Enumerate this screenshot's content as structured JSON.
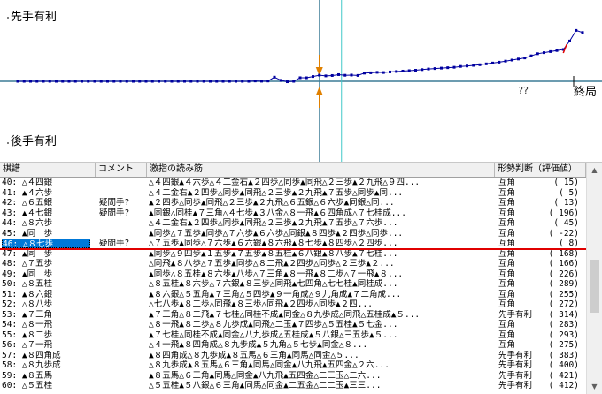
{
  "chart": {
    "y_top_label": "先手有利",
    "y_bottom_label": "後手有利",
    "x_end_label": "終局",
    "question_mark": "??",
    "colors": {
      "line": "#0000a0",
      "center": "#3c7c96",
      "cursor": "#40c8c8",
      "marker": "#e08000",
      "bad": "#e00000"
    }
  },
  "chart_data": {
    "type": "line",
    "title": "",
    "xlabel": "",
    "ylabel": "",
    "ylim": [
      -3000,
      3000
    ],
    "x": [
      1,
      2,
      3,
      4,
      5,
      6,
      7,
      8,
      9,
      10,
      11,
      12,
      13,
      14,
      15,
      16,
      17,
      18,
      19,
      20,
      21,
      22,
      23,
      24,
      25,
      26,
      27,
      28,
      29,
      30,
      31,
      32,
      33,
      34,
      35,
      36,
      37,
      38,
      39,
      40,
      41,
      42,
      43,
      44,
      45,
      46,
      47,
      48,
      49,
      50,
      51,
      52,
      53,
      54,
      55,
      56,
      57,
      58,
      59,
      60,
      61,
      62,
      63,
      64,
      65,
      66,
      67,
      68,
      69,
      70,
      71,
      72,
      73,
      74,
      75,
      76,
      77,
      78,
      79,
      80,
      81,
      82,
      83,
      84,
      85,
      86,
      87,
      88,
      89
    ],
    "values": [
      0,
      0,
      0,
      0,
      0,
      0,
      0,
      0,
      0,
      0,
      0,
      0,
      0,
      0,
      0,
      0,
      0,
      0,
      0,
      0,
      0,
      0,
      0,
      0,
      0,
      0,
      0,
      0,
      0,
      0,
      0,
      0,
      0,
      0,
      0,
      0,
      0,
      15,
      5,
      13,
      196,
      45,
      -22,
      0,
      168,
      166,
      226,
      289,
      255,
      272,
      314,
      283,
      293,
      275,
      383,
      400,
      421,
      412,
      440,
      460,
      480,
      500,
      520,
      550,
      580,
      600,
      620,
      640,
      660,
      700,
      720,
      750,
      780,
      820,
      860,
      900,
      950,
      1000,
      1050,
      1100,
      1200,
      1300,
      1350,
      1400,
      1450,
      1500,
      1900,
      2400,
      2300
    ],
    "cursor_move": 48,
    "questionable_moves": [
      42,
      43,
      48
    ]
  },
  "grid": {
    "headers": [
      "棋譜",
      "コメント",
      "激指の読み筋",
      "形勢判断（評価値）"
    ],
    "rows": [
      {
        "move": "40: △４四銀",
        "comment": "",
        "pv": "△４四銀▲４六歩△４二金右▲２四歩△同歩▲同飛△２三歩▲２九飛△９四...",
        "eval": "互角",
        "value": "(     15)"
      },
      {
        "move": "41: ▲４六歩",
        "comment": "",
        "pv": "△４二金右▲２四歩△同歩▲同飛△２三歩▲２九飛▲７五歩△同歩▲同...",
        "eval": "互角",
        "value": "(      5)"
      },
      {
        "move": "42: △６五銀",
        "comment": "疑問手?",
        "pv": "▲２四歩△同歩▲同飛△２三歩▲２九飛△６五銀△６六歩▲同銀△同...",
        "eval": "互角",
        "value": "(     13)"
      },
      {
        "move": "43: ▲４七銀",
        "comment": "疑問手?",
        "pv": "▲同銀△同桂▲７三角△４七歩▲３八金△８一飛▲６四角成△７七桂成...",
        "eval": "互角",
        "value": "(    196)"
      },
      {
        "move": "44: △８六歩",
        "comment": "",
        "pv": "△４二金右▲２四歩△同歩▲同飛△２三歩▲２九飛▲７五歩△７六歩...",
        "eval": "互角",
        "value": "(     45)"
      },
      {
        "move": "45: ▲同　歩",
        "comment": "",
        "pv": "▲同歩△７五歩▲同歩△７六歩▲６六歩△同銀▲８四歩▲２四歩△同歩...",
        "eval": "互角",
        "value": "(    -22)"
      },
      {
        "move": "46: △８七歩",
        "comment": "疑問手?",
        "pv": "△７五歩▲同歩△７六歩▲６六銀▲８六飛▲８七歩▲８四歩△２四歩...",
        "eval": "互角",
        "value": "(      8)"
      },
      {
        "move": "47: ▲同　歩",
        "comment": "",
        "pv": "▲同歩△９四歩▲１五歩▲７五歩▲８五桂▲６八銀▲８八歩▲７七桂...",
        "eval": "互角",
        "value": "(    168)"
      },
      {
        "move": "48: △７五歩",
        "comment": "",
        "pv": "△同飛▲８八歩△７五歩▲同歩△８二飛▲２四歩△同歩△２三歩▲２...",
        "eval": "互角",
        "value": "(    166)"
      },
      {
        "move": "49: ▲同　歩",
        "comment": "",
        "pv": "▲同歩△８五桂▲８六歩▲八歩△７三角▲８一飛▲８二歩△７一飛▲８...",
        "eval": "互角",
        "value": "(    226)"
      },
      {
        "move": "50: △８五桂",
        "comment": "",
        "pv": "△８五桂▲８六歩△７六銀▲８三歩△同飛▲七四角△七七桂▲同桂成...",
        "eval": "互角",
        "value": "(    289)"
      },
      {
        "move": "51: ▲８六銀",
        "comment": "",
        "pv": "▲８六銀△５五角▲７三角△５四歩▲９一角成△９九角成▲７二角成...",
        "eval": "互角",
        "value": "(    255)"
      },
      {
        "move": "52: △８八歩",
        "comment": "",
        "pv": "△七八歩▲８二歩△同飛▲８三歩△同飛▲２四歩△同歩▲２四...",
        "eval": "互角",
        "value": "(    272)"
      },
      {
        "move": "53: ▲７三角",
        "comment": "",
        "pv": "▲７三角△８二飛▲７七桂△同桂不成▲同金△８九歩成△同飛△五桂成▲５...",
        "eval": "先手有利",
        "value": "(    314)"
      },
      {
        "move": "54: △８一飛",
        "comment": "",
        "pv": "△８一飛▲８二歩△８九歩成▲同飛△二玉▲７四歩△５五桂▲５七金...",
        "eval": "互角",
        "value": "(    283)"
      },
      {
        "move": "55: ▲８二歩",
        "comment": "",
        "pv": "▲７七桂△同桂不成▲同金△八九歩成△五桂成▲５八銀△三五歩▲５...",
        "eval": "互角",
        "value": "(    293)"
      },
      {
        "move": "56: △７一飛",
        "comment": "",
        "pv": "△４一飛▲８四角成△８九歩成▲５九角△５七歩▲同金△８...",
        "eval": "互角",
        "value": "(    275)"
      },
      {
        "move": "57: ▲８四角成",
        "comment": "",
        "pv": "▲８四角成△８九歩成▲８五馬△６三角▲同馬△同金△５...",
        "eval": "先手有利",
        "value": "(    383)"
      },
      {
        "move": "58: △８九歩成",
        "comment": "",
        "pv": "△８九歩成▲８五馬△６三角▲同馬△同金▲八九飛▲五四金△２六...",
        "eval": "先手有利",
        "value": "(    400)"
      },
      {
        "move": "59: ▲８五馬",
        "comment": "",
        "pv": "▲８五馬△６三角▲同馬△同金▲八九飛▲五四金△二三玉△二六...",
        "eval": "先手有利",
        "value": "(    421)"
      },
      {
        "move": "60: △５五桂",
        "comment": "",
        "pv": "△５五桂▲５八銀△６三角▲同馬△同金▲二五金△二二玉▲三三...",
        "eval": "先手有利",
        "value": "(    412)"
      }
    ]
  }
}
